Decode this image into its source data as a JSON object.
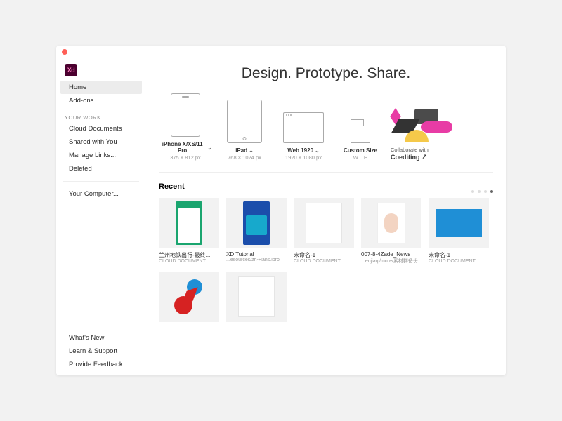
{
  "app": {
    "logo": "Xd",
    "hero": "Design. Prototype. Share."
  },
  "sidebar": {
    "items": [
      "Home",
      "Add-ons"
    ],
    "workHeader": "YOUR WORK",
    "workItems": [
      "Cloud Documents",
      "Shared with You",
      "Manage Links...",
      "Deleted"
    ],
    "computer": "Your Computer...",
    "footer": [
      "What's New",
      "Learn & Support",
      "Provide Feedback"
    ]
  },
  "presets": [
    {
      "name": "iPhone X/XS/11 Pro",
      "dim": "375 × 812 px"
    },
    {
      "name": "iPad",
      "dim": "768 × 1024 px"
    },
    {
      "name": "Web 1920",
      "dim": "1920 × 1080 px"
    }
  ],
  "custom": {
    "title": "Custom Size",
    "w": "W",
    "h": "H"
  },
  "promo": {
    "sub": "Collaborate with",
    "title": "Coediting"
  },
  "recentTitle": "Recent",
  "recent": [
    {
      "name": "兰州地铁出行-最终...",
      "sub": "CLOUD DOCUMENT"
    },
    {
      "name": "XD Tutorial",
      "sub": "...esources/zh-Hans.lproj"
    },
    {
      "name": "未命名-1",
      "sub": "CLOUD DOCUMENT"
    },
    {
      "name": "007-8-4Zade_News",
      "sub": "...enjiaqi/more/素材群备份"
    },
    {
      "name": "未命名-1",
      "sub": "CLOUD DOCUMENT"
    }
  ]
}
